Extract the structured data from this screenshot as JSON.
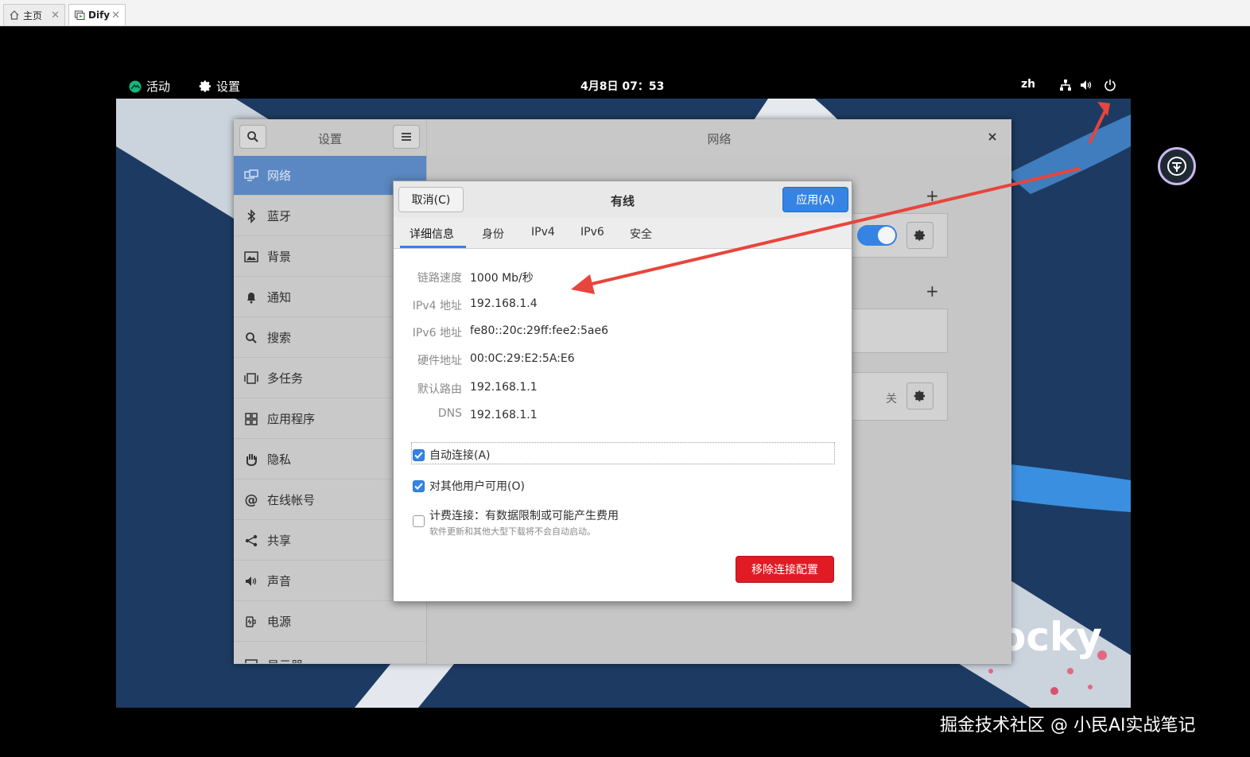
{
  "host_tabs": [
    {
      "label": "主页",
      "icon": "home-icon",
      "active": false
    },
    {
      "label": "Dify",
      "icon": "vm-icon",
      "active": true
    }
  ],
  "topbar": {
    "activities": "活动",
    "app_menu": "设置",
    "clock": "4月8日  07：53",
    "input_method": "zh"
  },
  "settings": {
    "sidebar_title": "设置",
    "panel_title": "网络",
    "sidebar_items": [
      {
        "label": "网络",
        "icon": "network-icon"
      },
      {
        "label": "蓝牙",
        "icon": "bluetooth-icon"
      },
      {
        "label": "背景",
        "icon": "background-icon"
      },
      {
        "label": "通知",
        "icon": "bell-icon"
      },
      {
        "label": "搜索",
        "icon": "search-icon"
      },
      {
        "label": "多任务",
        "icon": "multitask-icon"
      },
      {
        "label": "应用程序",
        "icon": "apps-icon"
      },
      {
        "label": "隐私",
        "icon": "hand-icon"
      },
      {
        "label": "在线帐号",
        "icon": "at-icon"
      },
      {
        "label": "共享",
        "icon": "share-icon"
      },
      {
        "label": "声音",
        "icon": "speaker-icon"
      },
      {
        "label": "电源",
        "icon": "power-plug-icon"
      },
      {
        "label": "显示器",
        "icon": "display-icon"
      }
    ],
    "vpn_state": "关"
  },
  "dialog": {
    "title": "有线",
    "cancel_label": "取消(C)",
    "apply_label": "应用(A)",
    "tabs": [
      "详细信息",
      "身份",
      "IPv4",
      "IPv6",
      "安全"
    ],
    "details": [
      {
        "label": "链路速度",
        "value": "1000 Mb/秒"
      },
      {
        "label": "IPv4 地址",
        "value": "192.168.1.4"
      },
      {
        "label": "IPv6 地址",
        "value": "fe80::20c:29ff:fee2:5ae6"
      },
      {
        "label": "硬件地址",
        "value": "00:0C:29:E2:5A:E6"
      },
      {
        "label": "默认路由",
        "value": "192.168.1.1"
      },
      {
        "label": "DNS",
        "value": "192.168.1.1"
      }
    ],
    "auto_connect": {
      "label": "自动连接(A)",
      "checked": true
    },
    "all_users": {
      "label": "对其他用户可用(O)",
      "checked": true
    },
    "metered": {
      "label": "计费连接：有数据限制或可能产生费用",
      "hint": "软件更新和其他大型下载将不会自动启动。",
      "checked": false
    },
    "remove_label": "移除连接配置"
  },
  "wallpaper_text": "ocky",
  "watermark": "掘金技术社区 @ 小民AI实战笔记",
  "colors": {
    "accent": "#3584e4",
    "destructive": "#e01b24",
    "annotation_arrow": "#e8453c"
  }
}
